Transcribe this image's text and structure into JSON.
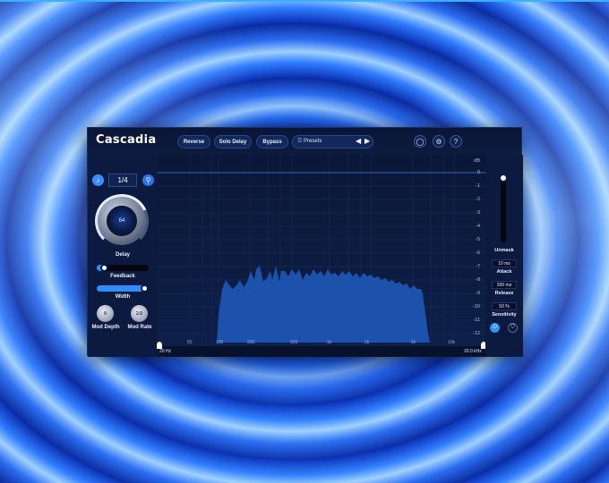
{
  "plugin": {
    "title": "Cascadia",
    "buttons": {
      "reverse": "Reverse",
      "solo_delay": "Solo Delay",
      "bypass": "Bypass"
    },
    "presets": {
      "label": "Presets",
      "menu_icon": "☰"
    },
    "icons": {
      "headphone": "◯",
      "settings": "⚙",
      "help": "?"
    }
  },
  "left_panel": {
    "division": "1/4",
    "delay": {
      "label": "Delay",
      "value": "64",
      "level": 0.72
    },
    "feedback": {
      "label": "Feedback",
      "level": 0.15
    },
    "width": {
      "label": "Width",
      "level": 1.0
    },
    "mod_depth": {
      "label": "Mod Depth",
      "value": "0"
    },
    "mod_rate": {
      "label": "Mod Rate",
      "value": "2.0"
    }
  },
  "graph": {
    "db_unit": "dB",
    "db_ticks": [
      "0",
      "-1",
      "-2",
      "-3",
      "-4",
      "-5",
      "-6",
      "-7",
      "-8",
      "-9",
      "-10",
      "-11",
      "-12"
    ],
    "freq_ticks": [
      "50",
      "100",
      "200",
      "500",
      "1k",
      "2k",
      "5k",
      "10k"
    ],
    "range_low": "20 Hz",
    "range_high": "20.0 kHz",
    "spectrum_color": "#1e58b8"
  },
  "right_panel": {
    "unmask": {
      "label": "Unmask"
    },
    "attack": {
      "label": "Attack",
      "value": "10 ms"
    },
    "release": {
      "label": "Release",
      "value": "300 ms"
    },
    "sensitivity": {
      "label": "Sensitivity",
      "value": "50 %"
    }
  },
  "colors": {
    "accent": "#2f8dff",
    "panel": "#0c1a3c"
  }
}
